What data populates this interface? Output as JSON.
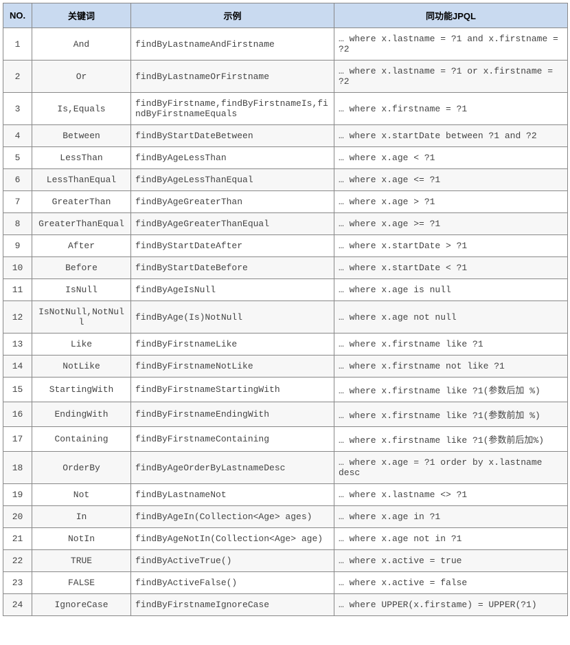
{
  "headers": {
    "no": "NO.",
    "keyword": "关键词",
    "example": "示例",
    "jpql": "同功能JPQL"
  },
  "rows": [
    {
      "no": "1",
      "keyword": "And",
      "example": "findByLastnameAndFirstname",
      "jpql": "… where x.lastname = ?1 and x.firstname = ?2"
    },
    {
      "no": "2",
      "keyword": "Or",
      "example": "findByLastnameOrFirstname",
      "jpql": "… where x.lastname = ?1 or x.firstname = ?2"
    },
    {
      "no": "3",
      "keyword": "Is,Equals",
      "example": "findByFirstname,findByFirstnameIs,findByFirstnameEquals",
      "jpql": "… where x.firstname = ?1"
    },
    {
      "no": "4",
      "keyword": "Between",
      "example": "findByStartDateBetween",
      "jpql": "… where x.startDate between ?1 and ?2"
    },
    {
      "no": "5",
      "keyword": "LessThan",
      "example": "findByAgeLessThan",
      "jpql": "… where x.age < ?1"
    },
    {
      "no": "6",
      "keyword": "LessThanEqual",
      "example": "findByAgeLessThanEqual",
      "jpql": "… where x.age <= ?1"
    },
    {
      "no": "7",
      "keyword": "GreaterThan",
      "example": "findByAgeGreaterThan",
      "jpql": "… where x.age > ?1"
    },
    {
      "no": "8",
      "keyword": "GreaterThanEqual",
      "example": "findByAgeGreaterThanEqual",
      "jpql": "… where x.age >= ?1"
    },
    {
      "no": "9",
      "keyword": "After",
      "example": "findByStartDateAfter",
      "jpql": "… where x.startDate > ?1"
    },
    {
      "no": "10",
      "keyword": "Before",
      "example": "findByStartDateBefore",
      "jpql": "… where x.startDate < ?1"
    },
    {
      "no": "11",
      "keyword": "IsNull",
      "example": "findByAgeIsNull",
      "jpql": "… where x.age is null"
    },
    {
      "no": "12",
      "keyword": "IsNotNull,NotNull",
      "example": "findByAge(Is)NotNull",
      "jpql": "… where x.age not null"
    },
    {
      "no": "13",
      "keyword": "Like",
      "example": "findByFirstnameLike",
      "jpql": "… where x.firstname like ?1"
    },
    {
      "no": "14",
      "keyword": "NotLike",
      "example": "findByFirstnameNotLike",
      "jpql": "… where x.firstname not like ?1"
    },
    {
      "no": "15",
      "keyword": "StartingWith",
      "example": "findByFirstnameStartingWith",
      "jpql": "… where x.firstname like ?1(参数后加 %)"
    },
    {
      "no": "16",
      "keyword": "EndingWith",
      "example": "findByFirstnameEndingWith",
      "jpql": "… where x.firstname like ?1(参数前加 %)"
    },
    {
      "no": "17",
      "keyword": "Containing",
      "example": "findByFirstnameContaining",
      "jpql": "… where x.firstname like ?1(参数前后加%)"
    },
    {
      "no": "18",
      "keyword": "OrderBy",
      "example": "findByAgeOrderByLastnameDesc",
      "jpql": "… where x.age = ?1 order by x.lastname desc"
    },
    {
      "no": "19",
      "keyword": "Not",
      "example": "findByLastnameNot",
      "jpql": "… where x.lastname <> ?1"
    },
    {
      "no": "20",
      "keyword": "In",
      "example": "findByAgeIn(Collection<Age> ages)",
      "jpql": "… where x.age in ?1"
    },
    {
      "no": "21",
      "keyword": "NotIn",
      "example": "findByAgeNotIn(Collection<Age> age)",
      "jpql": "… where x.age not in ?1"
    },
    {
      "no": "22",
      "keyword": "TRUE",
      "example": "findByActiveTrue()",
      "jpql": "… where x.active = true"
    },
    {
      "no": "23",
      "keyword": "FALSE",
      "example": "findByActiveFalse()",
      "jpql": "… where x.active = false"
    },
    {
      "no": "24",
      "keyword": "IgnoreCase",
      "example": "findByFirstnameIgnoreCase",
      "jpql": "… where UPPER(x.firstame) = UPPER(?1)"
    }
  ]
}
